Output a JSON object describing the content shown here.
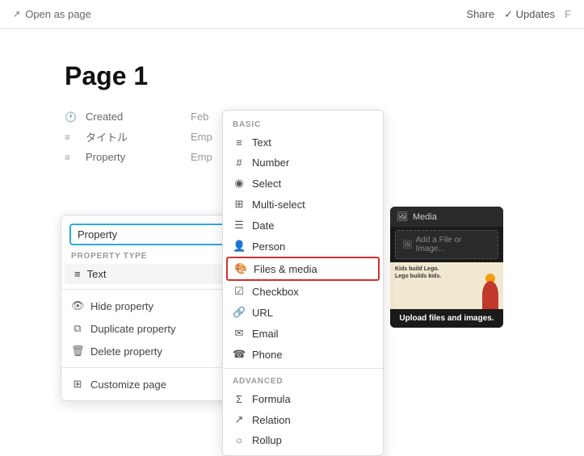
{
  "topbar": {
    "open_as_page": "Open as page",
    "share": "Share",
    "updates": "Updates",
    "filter": "F"
  },
  "page": {
    "title": "Page 1"
  },
  "properties": [
    {
      "icon": "clock",
      "name": "Created",
      "value": "Feb"
    },
    {
      "icon": "list",
      "name": "タイトル",
      "value": "Emp"
    },
    {
      "icon": "list",
      "name": "Property",
      "value": "Emp"
    }
  ],
  "property_edit": {
    "input_value": "Property",
    "type_label": "PROPERTY TYPE",
    "type_value": "Text",
    "menu_items": [
      {
        "icon": "👁",
        "label": "Hide property",
        "has_arrow": true
      },
      {
        "icon": "⧉",
        "label": "Duplicate property",
        "has_arrow": false
      },
      {
        "icon": "🗑",
        "label": "Delete property",
        "has_arrow": false
      },
      {
        "icon": "⊞",
        "label": "Customize page",
        "has_arrow": false
      }
    ]
  },
  "dropdown": {
    "basic_label": "BASIC",
    "basic_items": [
      {
        "icon": "≡",
        "label": "Text"
      },
      {
        "icon": "#",
        "label": "Number"
      },
      {
        "icon": "◉",
        "label": "Select"
      },
      {
        "icon": "⊞",
        "label": "Multi-select"
      },
      {
        "icon": "☰",
        "label": "Date"
      },
      {
        "icon": "👤",
        "label": "Person"
      },
      {
        "icon": "🎨",
        "label": "Files & media",
        "highlighted": true
      },
      {
        "icon": "✓",
        "label": "Checkbox"
      },
      {
        "icon": "🔗",
        "label": "URL"
      },
      {
        "icon": "✉",
        "label": "Email"
      },
      {
        "icon": "☎",
        "label": "Phone"
      }
    ],
    "advanced_label": "ADVANCED",
    "advanced_items": [
      {
        "icon": "Σ",
        "label": "Formula"
      },
      {
        "icon": "↗",
        "label": "Relation"
      },
      {
        "icon": "○",
        "label": "Rollup"
      }
    ]
  },
  "media": {
    "header": "Media",
    "add_text": "Add a File or Image...",
    "caption": "Upload files and images.",
    "lego_text": "Kids build Lego. Lego builds kids.",
    "image_alt": "lego article"
  }
}
